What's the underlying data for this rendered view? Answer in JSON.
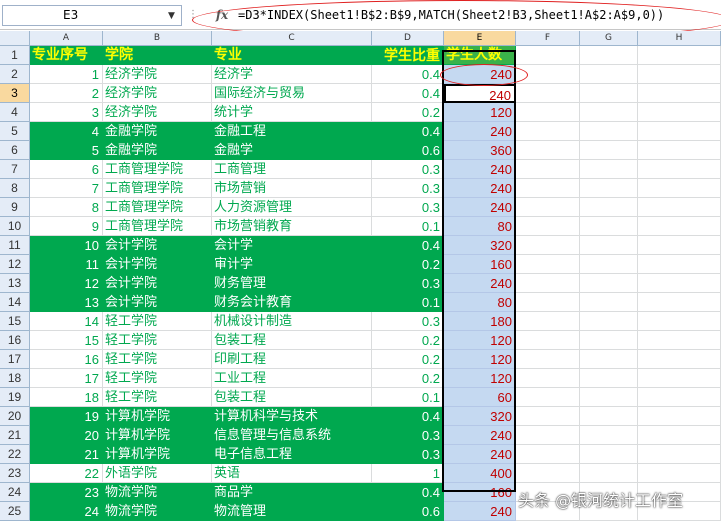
{
  "formula_bar": {
    "cell_ref": "E3",
    "fx_label": "fx",
    "formula": "=D3*INDEX(Sheet1!B$2:B$9,MATCH(Sheet2!B3,Sheet1!A$2:A$9,0))"
  },
  "columns": [
    "A",
    "B",
    "C",
    "D",
    "E",
    "F",
    "G",
    "H"
  ],
  "header_row": {
    "row_num": "1",
    "a": "专业序号",
    "b": "学院",
    "c": "专业",
    "d": "学生比重",
    "e": "学生人数"
  },
  "rows": [
    {
      "row_num": "2",
      "a": "1",
      "b": "经济学院",
      "c": "经济学",
      "d": "0.4",
      "e": "240",
      "band": "white"
    },
    {
      "row_num": "3",
      "a": "2",
      "b": "经济学院",
      "c": "国际经济与贸易",
      "d": "0.4",
      "e": "240",
      "band": "white"
    },
    {
      "row_num": "4",
      "a": "3",
      "b": "经济学院",
      "c": "统计学",
      "d": "0.2",
      "e": "120",
      "band": "white"
    },
    {
      "row_num": "5",
      "a": "4",
      "b": "金融学院",
      "c": "金融工程",
      "d": "0.4",
      "e": "240",
      "band": "green"
    },
    {
      "row_num": "6",
      "a": "5",
      "b": "金融学院",
      "c": "金融学",
      "d": "0.6",
      "e": "360",
      "band": "green"
    },
    {
      "row_num": "7",
      "a": "6",
      "b": "工商管理学院",
      "c": "工商管理",
      "d": "0.3",
      "e": "240",
      "band": "white"
    },
    {
      "row_num": "8",
      "a": "7",
      "b": "工商管理学院",
      "c": "市场营销",
      "d": "0.3",
      "e": "240",
      "band": "white"
    },
    {
      "row_num": "9",
      "a": "8",
      "b": "工商管理学院",
      "c": "人力资源管理",
      "d": "0.3",
      "e": "240",
      "band": "white"
    },
    {
      "row_num": "10",
      "a": "9",
      "b": "工商管理学院",
      "c": "市场营销教育",
      "d": "0.1",
      "e": "80",
      "band": "white"
    },
    {
      "row_num": "11",
      "a": "10",
      "b": "会计学院",
      "c": "会计学",
      "d": "0.4",
      "e": "320",
      "band": "green"
    },
    {
      "row_num": "12",
      "a": "11",
      "b": "会计学院",
      "c": "审计学",
      "d": "0.2",
      "e": "160",
      "band": "green"
    },
    {
      "row_num": "13",
      "a": "12",
      "b": "会计学院",
      "c": "财务管理",
      "d": "0.3",
      "e": "240",
      "band": "green"
    },
    {
      "row_num": "14",
      "a": "13",
      "b": "会计学院",
      "c": "财务会计教育",
      "d": "0.1",
      "e": "80",
      "band": "green"
    },
    {
      "row_num": "15",
      "a": "14",
      "b": "轻工学院",
      "c": "机械设计制造",
      "d": "0.3",
      "e": "180",
      "band": "white"
    },
    {
      "row_num": "16",
      "a": "15",
      "b": "轻工学院",
      "c": "包装工程",
      "d": "0.2",
      "e": "120",
      "band": "white"
    },
    {
      "row_num": "17",
      "a": "16",
      "b": "轻工学院",
      "c": "印刷工程",
      "d": "0.2",
      "e": "120",
      "band": "white"
    },
    {
      "row_num": "18",
      "a": "17",
      "b": "轻工学院",
      "c": "工业工程",
      "d": "0.2",
      "e": "120",
      "band": "white"
    },
    {
      "row_num": "19",
      "a": "18",
      "b": "轻工学院",
      "c": "包装工程",
      "d": "0.1",
      "e": "60",
      "band": "white"
    },
    {
      "row_num": "20",
      "a": "19",
      "b": "计算机学院",
      "c": "计算机科学与技术",
      "d": "0.4",
      "e": "320",
      "band": "green"
    },
    {
      "row_num": "21",
      "a": "20",
      "b": "计算机学院",
      "c": "信息管理与信息系统",
      "d": "0.3",
      "e": "240",
      "band": "green"
    },
    {
      "row_num": "22",
      "a": "21",
      "b": "计算机学院",
      "c": "电子信息工程",
      "d": "0.3",
      "e": "240",
      "band": "green"
    },
    {
      "row_num": "23",
      "a": "22",
      "b": "外语学院",
      "c": "英语",
      "d": "1",
      "e": "400",
      "band": "white"
    },
    {
      "row_num": "24",
      "a": "23",
      "b": "物流学院",
      "c": "商品学",
      "d": "0.4",
      "e": "160",
      "band": "green"
    },
    {
      "row_num": "25",
      "a": "24",
      "b": "物流学院",
      "c": "物流管理",
      "d": "0.6",
      "e": "240",
      "band": "green"
    }
  ],
  "watermark": "头条 @银河统计工作室",
  "colors": {
    "band_green": "#00a84f",
    "header_text": "#ffff00",
    "value_red": "#c00000",
    "annotation_red": "#e02020"
  }
}
